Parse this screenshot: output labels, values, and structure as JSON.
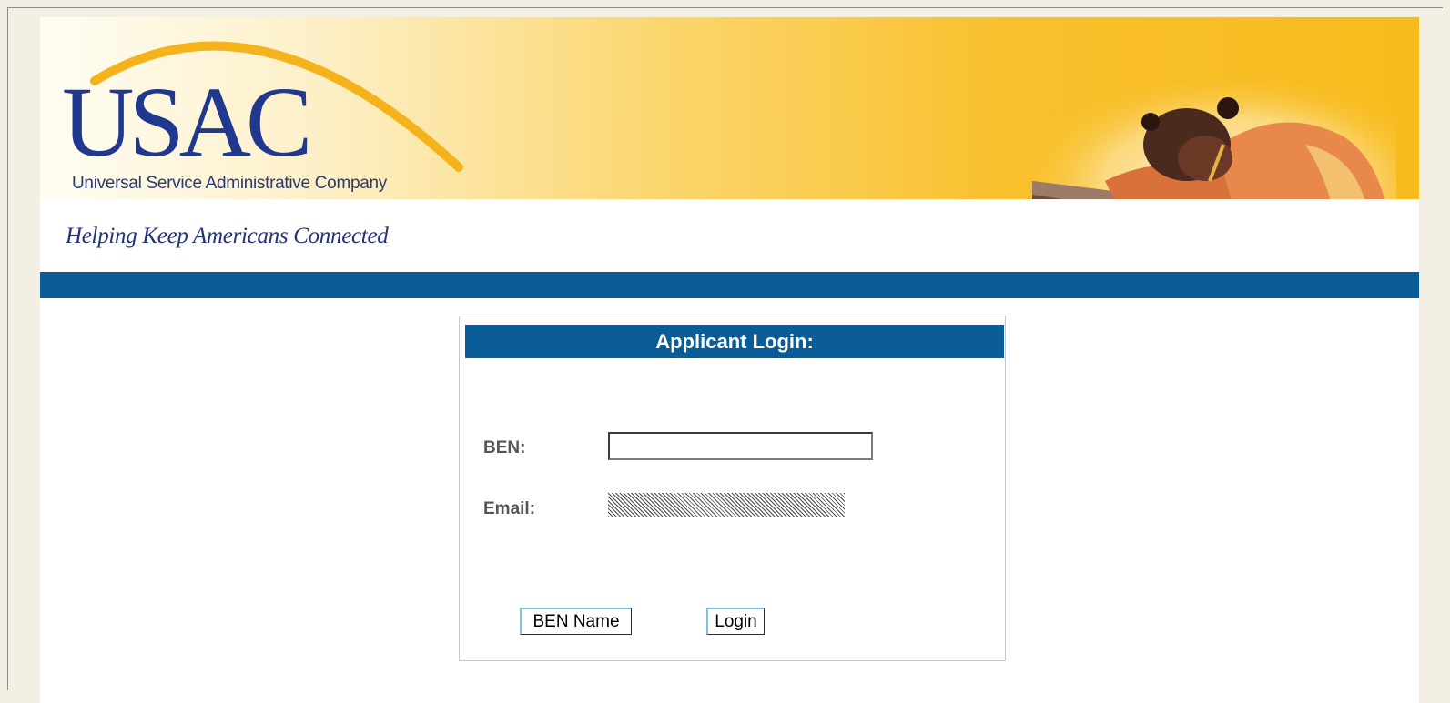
{
  "header": {
    "logo_text": "USAC",
    "company_name": "Universal Service Administrative Company",
    "tagline": "Helping Keep Americans Connected",
    "colors": {
      "banner_gold": "#f9c02d",
      "brand_navy": "#20398e",
      "bar_blue": "#0a5d96"
    }
  },
  "login": {
    "title": "Applicant Login:",
    "ben_label": "BEN:",
    "ben_value": "",
    "email_label": "Email:",
    "ben_name_button": "BEN Name",
    "login_button": "Login"
  }
}
